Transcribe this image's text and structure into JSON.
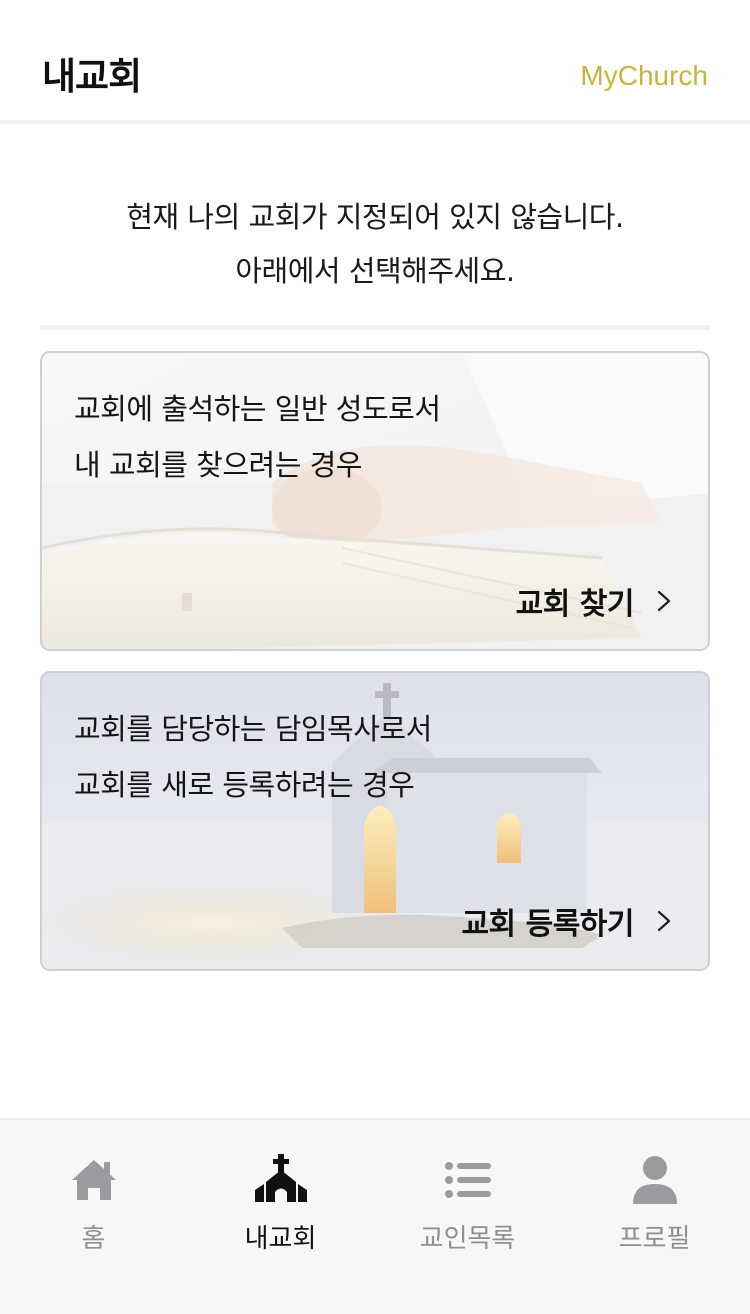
{
  "header": {
    "title": "내교회",
    "brand": "MyChurch"
  },
  "notice": {
    "line1": "현재 나의 교회가 지정되어 있지 않습니다.",
    "line2": "아래에서 선택해주세요."
  },
  "cards": [
    {
      "line1": "교회에 출석하는 일반 성도로서",
      "line2": "내 교회를 찾으려는 경우",
      "action": "교회 찾기"
    },
    {
      "line1": "교회를 담당하는 담임목사로서",
      "line2": "교회를 새로 등록하려는 경우",
      "action": "교회 등록하기"
    }
  ],
  "tabs": [
    {
      "label": "홈",
      "icon": "home-icon",
      "active": false
    },
    {
      "label": "내교회",
      "icon": "church-icon",
      "active": true
    },
    {
      "label": "교인목록",
      "icon": "list-icon",
      "active": false
    },
    {
      "label": "프로필",
      "icon": "person-icon",
      "active": false
    }
  ],
  "colors": {
    "brand": "#c8b43a",
    "inactive": "#8e8e93",
    "active": "#111111"
  }
}
